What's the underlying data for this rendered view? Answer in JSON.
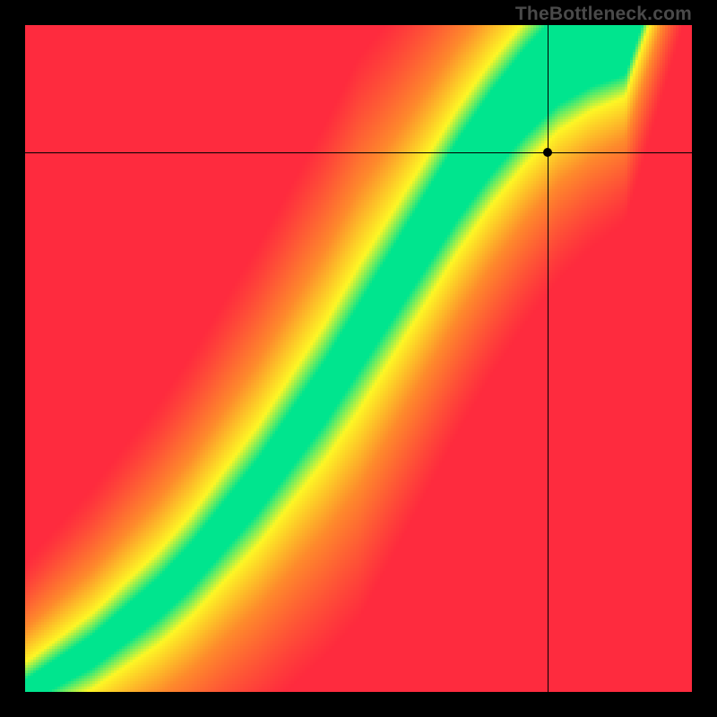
{
  "watermark": "TheBottleneck.com",
  "crosshair": {
    "x_frac": 0.783,
    "y_frac": 0.191
  },
  "chart_data": {
    "type": "heatmap",
    "title": "",
    "xlabel": "",
    "ylabel": "",
    "xlim": [
      0,
      1
    ],
    "ylim": [
      0,
      1
    ],
    "grid": false,
    "legend": "none",
    "description": "Bottleneck fit heatmap; green band indicates balanced CPU/GPU pairing, red/orange indicates bottleneck.",
    "optimal_curve": {
      "x": [
        0.0,
        0.05,
        0.1,
        0.15,
        0.2,
        0.25,
        0.3,
        0.35,
        0.4,
        0.45,
        0.5,
        0.55,
        0.6,
        0.65,
        0.7,
        0.75,
        0.8,
        0.85,
        0.9
      ],
      "y": [
        0.0,
        0.03,
        0.06,
        0.1,
        0.14,
        0.19,
        0.25,
        0.31,
        0.38,
        0.45,
        0.53,
        0.61,
        0.69,
        0.77,
        0.84,
        0.9,
        0.95,
        0.98,
        1.0
      ]
    },
    "band_half_width": 0.035,
    "crosshair_point": {
      "x": 0.783,
      "y": 0.809
    },
    "color_stops": {
      "red": "#fe2b3e",
      "orange": "#fe8a2c",
      "yellow": "#fdf725",
      "green": "#00e58f"
    }
  }
}
